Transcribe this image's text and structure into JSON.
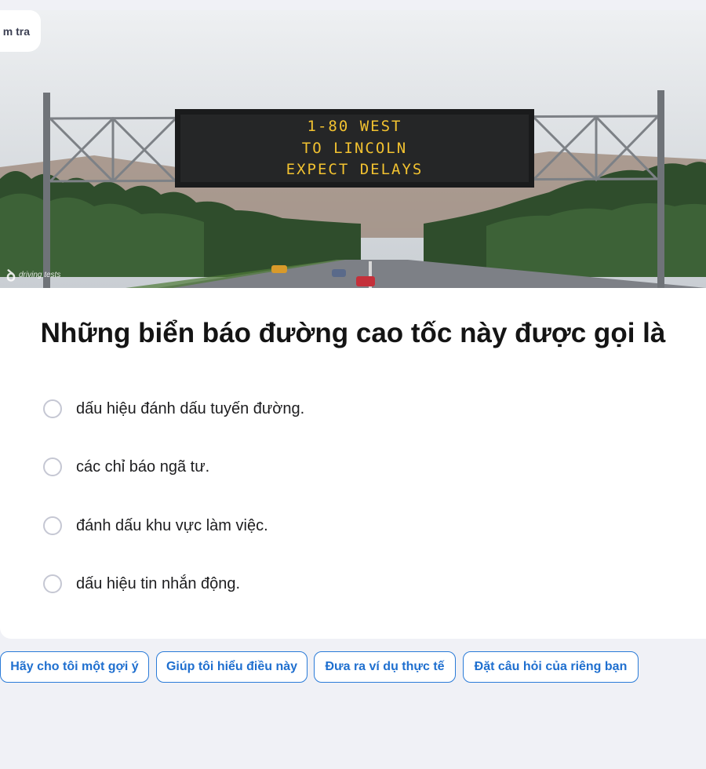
{
  "tab_label": "m tra",
  "image": {
    "sign_lines": [
      "1-80 WEST",
      "TO LINCOLN",
      "EXPECT DELAYS"
    ],
    "logo_text": "driving tests"
  },
  "question": "Những biển báo đường cao tốc này được gọi là",
  "options": [
    "dấu hiệu đánh dấu tuyến đường.",
    "các chỉ báo ngã tư.",
    "đánh dấu khu vực làm việc.",
    "dấu hiệu tin nhắn động."
  ],
  "help_chips": [
    "Hãy cho tôi một gợi ý",
    "Giúp tôi hiểu điều này",
    "Đưa ra ví dụ thực tế",
    "Đặt câu hỏi của riêng bạn"
  ],
  "colors": {
    "accent": "#1f6fcf",
    "page_bg": "#f0f1f6",
    "sign_text": "#f2c230"
  }
}
